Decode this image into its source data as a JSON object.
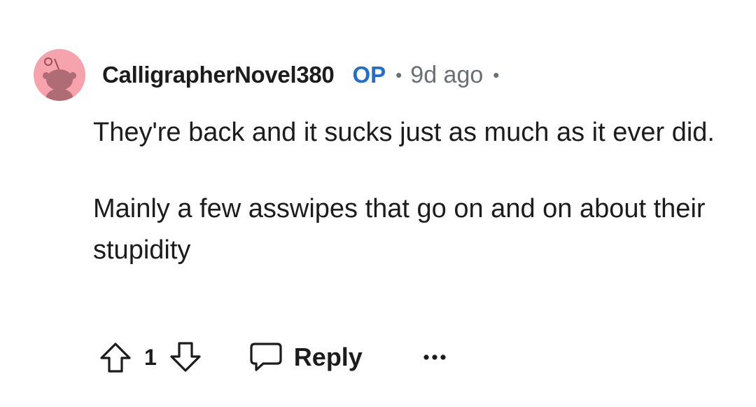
{
  "comment": {
    "author": "CalligrapherNovel380",
    "op_badge": "OP",
    "separator": "•",
    "timestamp": "9d ago",
    "paragraphs": [
      "They're back and it sucks just as much as it ever did.",
      "Mainly a few asswipes that go on and on about their stupidity"
    ],
    "avatar_color": "#f7a3ad",
    "op_color": "#1f6fd1",
    "meta_color": "#6a6f73"
  },
  "actions": {
    "upvote_icon": "arrow-up-icon",
    "vote_count": "1",
    "downvote_icon": "arrow-down-icon",
    "reply_icon": "speech-bubble-icon",
    "reply_label": "Reply",
    "more_icon": "ellipsis-icon"
  }
}
